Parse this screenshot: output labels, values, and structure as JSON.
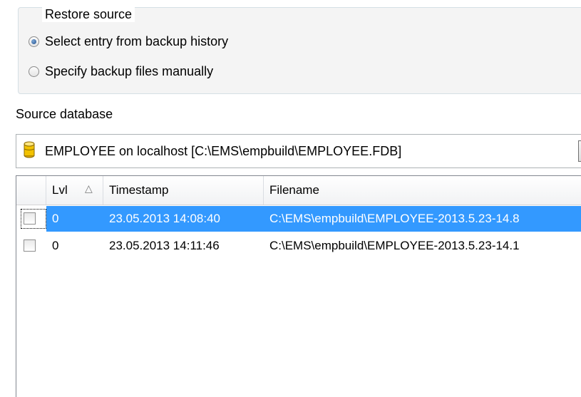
{
  "restore_source": {
    "caption": "Restore source",
    "options": [
      {
        "label": "Select entry from backup history",
        "checked": true
      },
      {
        "label": "Specify backup files manually",
        "checked": false
      }
    ]
  },
  "source_database": {
    "label": "Source database",
    "selected": "EMPLOYEE on localhost [C:\\EMS\\empbuild\\EMPLOYEE.FDB]",
    "icon": "database-icon"
  },
  "backup_grid": {
    "columns": [
      "Lvl",
      "Timestamp",
      "Filename"
    ],
    "sort_icon": "△",
    "rows": [
      {
        "lvl": "0",
        "timestamp": "23.05.2013 14:08:40",
        "filename": "C:\\EMS\\empbuild\\EMPLOYEE-2013.5.23-14.8",
        "selected": true,
        "checked": false
      },
      {
        "lvl": "0",
        "timestamp": "23.05.2013 14:11:46",
        "filename": "C:\\EMS\\empbuild\\EMPLOYEE-2013.5.23-14.1",
        "selected": false,
        "checked": false
      }
    ]
  },
  "colors": {
    "selection": "#3399ff",
    "db_icon": "#f2c200"
  }
}
